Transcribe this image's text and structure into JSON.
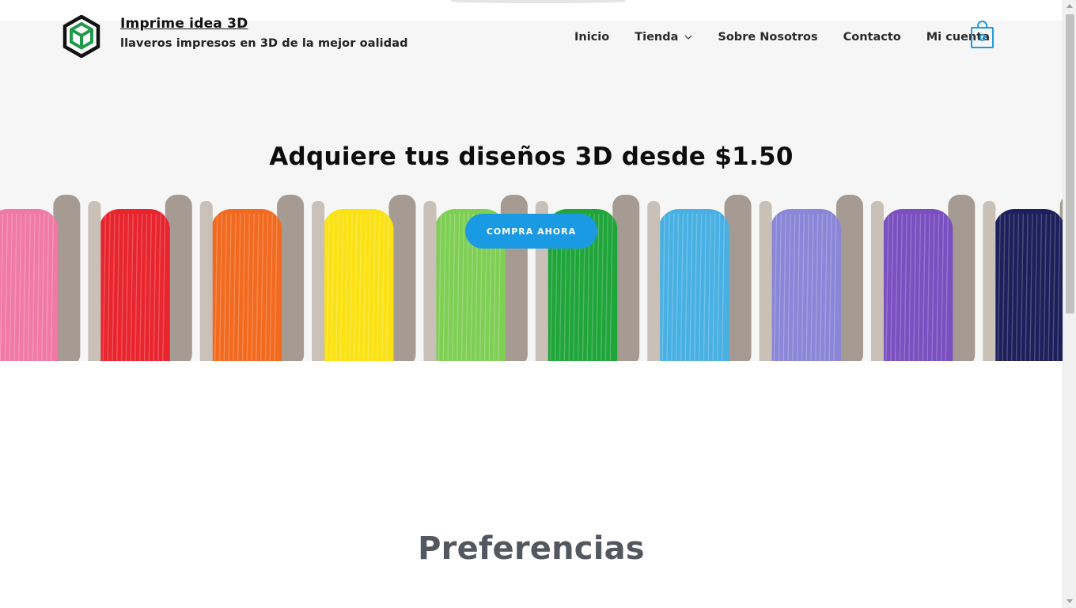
{
  "header": {
    "logo": "hexagon-cube-logo",
    "site_title": "Imprime idea 3D",
    "tagline": "llaveros impresos en 3D de la mejor oalidad"
  },
  "nav": {
    "items": [
      {
        "label": "Inicio"
      },
      {
        "label": "Tienda",
        "has_dropdown": true
      },
      {
        "label": "Sobre Nosotros"
      },
      {
        "label": "Contacto"
      },
      {
        "label": "Mi cuenta"
      }
    ],
    "cart_count": "0"
  },
  "hero": {
    "title": "Adquiere tus diseños 3D desde $1.50",
    "cta_label": "Compra ahora",
    "image": "filament-spools-rainbow",
    "spool_colors": [
      "#f07aa5",
      "#e8242e",
      "#f26a1f",
      "#fbe214",
      "#7fcf55",
      "#1fa53a",
      "#48b0e3",
      "#8a86d8",
      "#7a4fc0",
      "#1c1f5a"
    ]
  },
  "section": {
    "title": "Preferencias"
  },
  "colors": {
    "accent": "#1b9ae4",
    "logo_green": "#1e9a4a",
    "heading_gray": "#555760"
  }
}
